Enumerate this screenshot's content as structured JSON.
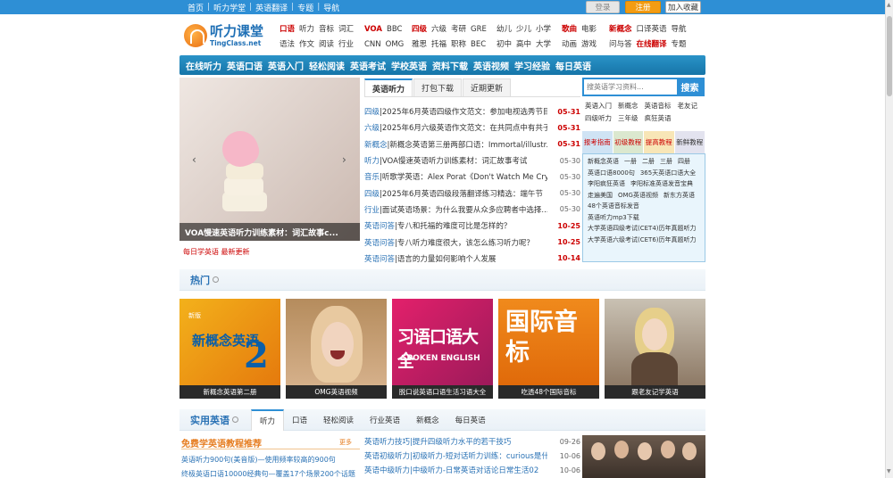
{
  "topbar": {
    "links": [
      "首页",
      "听力学堂",
      "英语翻译",
      "专题",
      "导航"
    ],
    "login": "登录",
    "register": "注册",
    "favorite": "加入收藏"
  },
  "logo": {
    "cn": "听力课堂",
    "en": "TingClass.net"
  },
  "categories": {
    "col1": [
      [
        "口语",
        "听力",
        "音标",
        "词汇"
      ],
      [
        "语法",
        "作文",
        "阅读",
        "行业"
      ]
    ],
    "col2": [
      [
        "VOA",
        "BBC"
      ],
      [
        "CNN",
        "OMG"
      ]
    ],
    "col3": [
      [
        "四级",
        "六级",
        "考研",
        "GRE"
      ],
      [
        "雅思",
        "托福",
        "职称",
        "BEC"
      ]
    ],
    "col4": [
      [
        "幼儿",
        "少儿",
        "小学"
      ],
      [
        "初中",
        "高中",
        "大学"
      ]
    ],
    "col5": [
      [
        "歌曲",
        "电影"
      ],
      [
        "动画",
        "游戏"
      ]
    ],
    "col6": [
      [
        "新概念",
        "口译英语",
        "导航"
      ],
      [
        "问与答",
        "在线翻译",
        "专题"
      ]
    ]
  },
  "nav": [
    "在线听力",
    "英语口语",
    "英语入门",
    "轻松阅读",
    "英语考试",
    "学校英语",
    "资料下载",
    "英语视频",
    "学习经验",
    "每日英语"
  ],
  "slider": {
    "caption": "VOA慢速英语听力训练素材：词汇故事c...",
    "sub": "每日学英语 最新更新"
  },
  "tabs1": [
    "英语听力",
    "打包下载",
    "近期更新"
  ],
  "news1": [
    {
      "cat": "四级",
      "title": "|2025年6月英语四级作文范文：参加电视选秀节目",
      "date": "05-31",
      "hot": true
    },
    {
      "cat": "六级",
      "title": "|2025年6月六级英语作文范文：在共同点中有共子",
      "date": "05-31",
      "hot": true
    },
    {
      "cat": "新概念",
      "title": "|新概念英语第三册两部口语：Immortal/illustr...",
      "date": "05-31",
      "hot": true
    },
    {
      "cat": "听力",
      "title": "|VOA慢速英语听力训练素材：词汇故事考试",
      "date": "05-30",
      "hot": false
    },
    {
      "cat": "音乐",
      "title": "|听歌学英语：Alex Porat《Don't Watch Me Cry》",
      "date": "05-30",
      "hot": false
    },
    {
      "cat": "四级",
      "title": "|2025年6月英语四级段落翻译练习精选：端午节",
      "date": "05-30",
      "hot": false
    },
    {
      "cat": "行业",
      "title": "|面试英语场景：为什么我要从众多应聘者中选择...",
      "date": "05-30",
      "hot": false
    },
    {
      "cat": "英语问答",
      "title": "|专八和托福的难度可比是怎样的？",
      "date": "10-25",
      "hot": true
    },
    {
      "cat": "英语问答",
      "title": "|专八听力难度很大，该怎么练习听力呢？",
      "date": "10-25",
      "hot": true
    },
    {
      "cat": "英语问答",
      "title": "|语言的力量如何影响个人发展",
      "date": "10-14",
      "hot": true
    }
  ],
  "search": {
    "placeholder": "搜英语学习资料...",
    "button": "搜索"
  },
  "quicklinks": [
    [
      "英语入门",
      "新概念",
      "英语音标",
      "老友记"
    ],
    [
      "四级听力",
      "三年级",
      "疯狂英语"
    ]
  ],
  "iconrow": [
    "报考指南",
    "初级教程",
    "提高教程",
    "新鲜教程"
  ],
  "sidebox": [
    [
      "新概念英语",
      "一册",
      "二册",
      "三册",
      "四册"
    ],
    [
      "英语口语8000句",
      "365天英语口语大全"
    ],
    [
      "李阳疯狂英语",
      "李阳标准英语发音宝典"
    ],
    [
      "走遍美国",
      "OMG英语视频",
      "新东方英语"
    ],
    [
      "48个英语音标发音"
    ],
    [
      "英语听力mp3下载"
    ],
    [
      "大学英语四级考试(CET4)历年真题听力"
    ],
    [
      "大学英语六级考试(CET6)历年真题听力"
    ]
  ],
  "hot": {
    "title": "热门",
    "items": [
      {
        "caption": "新概念英语第二册",
        "cover": "新概念英语"
      },
      {
        "caption": "OMG英语视频",
        "cover": ""
      },
      {
        "caption": "脱口说英语口语生活习语大全",
        "cover": "习语口语大全"
      },
      {
        "caption": "吃透48个国际音标",
        "cover": "国际音标"
      },
      {
        "caption": "跟老友记学英语",
        "cover": ""
      }
    ]
  },
  "practical": {
    "title": "实用英语",
    "tabs": [
      "听力",
      "口语",
      "轻松阅读",
      "行业英语",
      "新概念",
      "每日英语"
    ]
  },
  "free": {
    "title": "免费学英语教程推荐",
    "more": "更多",
    "items": [
      "英语听力900句(美音版)—使用频率较高的900句",
      "终极英语口语10000经典句—覆盖17个场景200个话题"
    ]
  },
  "news2": [
    {
      "title": "英语听力技巧|提升四级听力水平的若干技巧",
      "date": "09-26"
    },
    {
      "title": "英语初级听力|初级听力-短对话听力训练：curious是什...",
      "date": "10-06"
    },
    {
      "title": "英语中级听力|中级听力-日常英语对话论日常生活02",
      "date": "10-06"
    }
  ]
}
